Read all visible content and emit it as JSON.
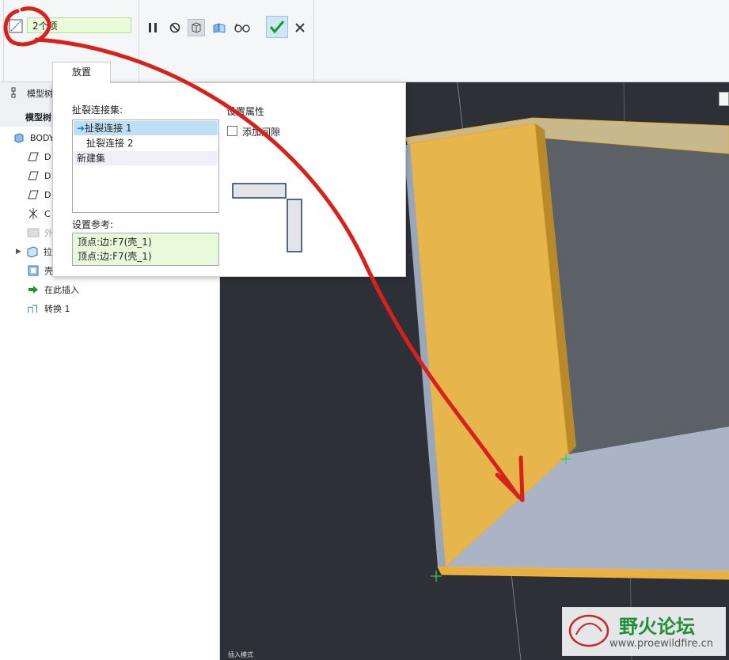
{
  "ribbon": {
    "item_count": "2个项"
  },
  "tabs": {
    "placement": "放置"
  },
  "tree": {
    "title": "模型树",
    "tab_label": "模型树",
    "items": [
      {
        "label": "BODY",
        "icon": "body-icon"
      },
      {
        "label": "D",
        "icon": "datum-plane-icon"
      },
      {
        "label": "D",
        "icon": "datum-plane-icon"
      },
      {
        "label": "D",
        "icon": "datum-plane-icon"
      },
      {
        "label": "C",
        "icon": "csys-icon"
      },
      {
        "label": "外",
        "icon": "appearance-icon"
      },
      {
        "label": "拉",
        "icon": "extrude-icon"
      },
      {
        "label": "壳",
        "icon": "shell-icon"
      },
      {
        "label": "在此插入",
        "icon": "insert-here-icon"
      },
      {
        "label": "转换 1",
        "icon": "convert-icon"
      }
    ]
  },
  "placement": {
    "set_header": "扯裂连接集:",
    "sets": [
      "扯裂连接 1",
      "扯裂连接 2",
      "新建集"
    ],
    "props_header": "设置属性",
    "add_gap_label": "添加间隙",
    "add_gap_checked": false,
    "ref_header": "设置参考:",
    "refs": [
      "顶点:边:F7(壳_1)",
      "顶点:边:F7(壳_1)"
    ]
  },
  "viewport": {
    "status": "插入模式"
  },
  "watermark": {
    "title": "野火论坛",
    "url": "www.proewildfire.cn"
  },
  "colors": {
    "accent": "#cfe6f7",
    "check_green": "#1a9a2a",
    "annotation_red": "#d8211b",
    "highlight_orange": "#f2b640"
  }
}
